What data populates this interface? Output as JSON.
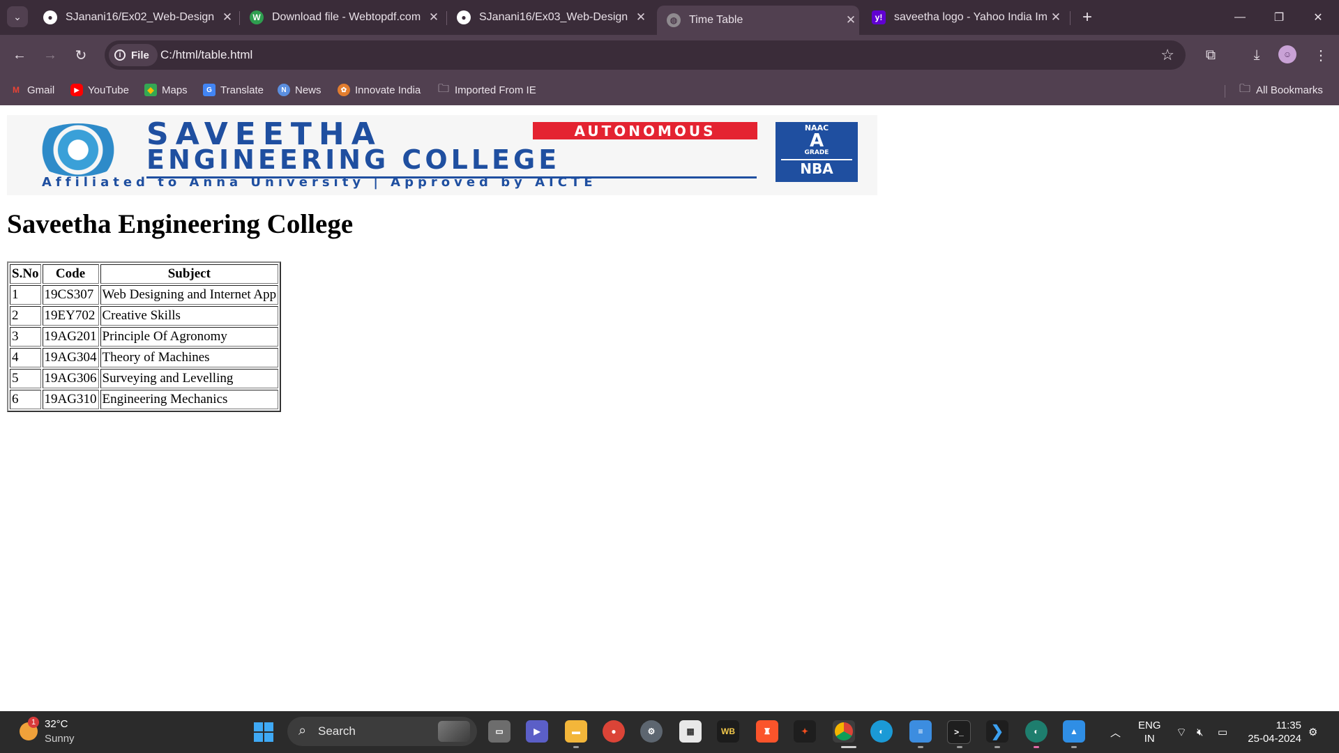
{
  "browser": {
    "tabs": [
      {
        "label": "SJanani16/Ex02_Web-Design",
        "favicon": "github-icon",
        "active": false
      },
      {
        "label": "Download file - Webtopdf.com",
        "favicon": "webtopdf-icon",
        "active": false
      },
      {
        "label": "SJanani16/Ex03_Web-Design",
        "favicon": "github-icon",
        "active": false
      },
      {
        "label": "Time Table",
        "favicon": "globe-icon",
        "active": true
      },
      {
        "label": "saveetha logo - Yahoo India Ima",
        "favicon": "yahoo-icon",
        "active": false
      }
    ],
    "omnibox": {
      "chip_label": "File",
      "url": "C:/html/table.html"
    },
    "bookmarks": [
      {
        "label": "Gmail",
        "icon": "gmail-icon"
      },
      {
        "label": "YouTube",
        "icon": "youtube-icon"
      },
      {
        "label": "Maps",
        "icon": "maps-icon"
      },
      {
        "label": "Translate",
        "icon": "translate-icon"
      },
      {
        "label": "News",
        "icon": "news-icon"
      },
      {
        "label": "Innovate India",
        "icon": "innovate-india-icon"
      },
      {
        "label": "Imported From IE",
        "icon": "folder-icon"
      }
    ],
    "all_bookmarks_label": "All Bookmarks"
  },
  "page": {
    "logo": {
      "name_line1": "SAVEETHA",
      "name_line2": "ENGINEERING COLLEGE",
      "tag": "AUTONOMOUS",
      "subtitle": "Affiliated to Anna University | Approved by AICTE",
      "badge_top": "NAAC",
      "badge_grade": "A",
      "badge_grade_label": "GRADE",
      "badge_nba": "NBA"
    },
    "heading": "Saveetha Engineering College",
    "table": {
      "headers": [
        "S.No",
        "Code",
        "Subject"
      ],
      "rows": [
        [
          "1",
          "19CS307",
          "Web Designing and Internet App"
        ],
        [
          "2",
          "19EY702",
          "Creative Skills"
        ],
        [
          "3",
          "19AG201",
          "Principle Of Agronomy"
        ],
        [
          "4",
          "19AG304",
          "Theory of Machines"
        ],
        [
          "5",
          "19AG306",
          "Surveying and Levelling"
        ],
        [
          "6",
          "19AG310",
          "Engineering Mechanics"
        ]
      ]
    }
  },
  "taskbar": {
    "weather": {
      "badge": "1",
      "temp": "32°C",
      "condition": "Sunny"
    },
    "search_label": "Search",
    "lang_line1": "ENG",
    "lang_line2": "IN",
    "time": "11:35",
    "date": "25-04-2024"
  },
  "colors": {
    "tab_bar": "#3a2c39",
    "toolbar": "#514050",
    "taskbar": "#2b2b2b",
    "logo_blue": "#1f4fa0",
    "logo_red": "#e42331"
  }
}
